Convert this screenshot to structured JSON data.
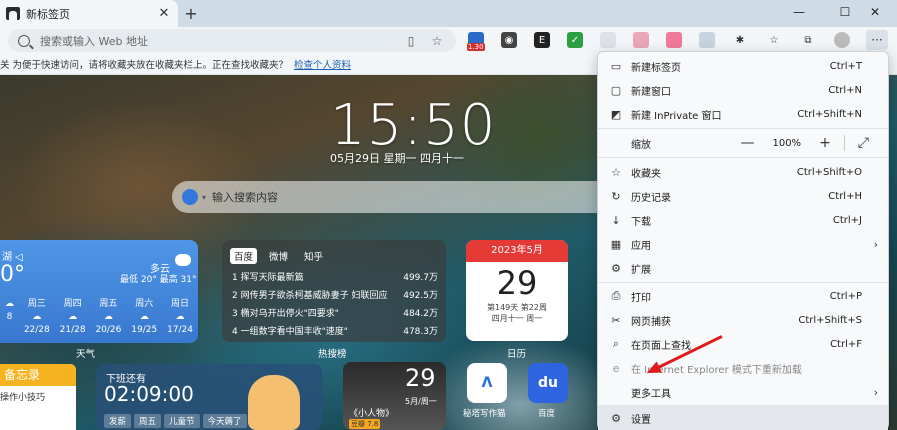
{
  "colors": {
    "accent": "#1a5fb4",
    "menu_bg": "#f7f9fb",
    "arrow": "#e11b1b",
    "weather_bg": "#4f96e6",
    "calendar_head": "#e53935"
  },
  "browser": {
    "tab_title": "新标签页",
    "tab_close": "✕",
    "new_tab": "+",
    "minimize": "—",
    "maximize": "☐",
    "close": "✕",
    "address_placeholder": "搜索或输入 Web 地址",
    "ext_badge": "1.30",
    "more": "···"
  },
  "favorites_bar": {
    "text": "关   为便于快速访问，请将收藏夹放在收藏夹栏上。正在查找收藏夹？",
    "link": "检查个人资料"
  },
  "ntp": {
    "time": "15:50",
    "date": "05月29日  星期一  四月十一",
    "search_placeholder": "输入搜索内容",
    "weather": {
      "location": "湖 ◁",
      "temp": "0°",
      "condition": "多云",
      "range": "最低 20°  最高 31°",
      "days": [
        {
          "name": "",
          "temp": "8"
        },
        {
          "name": "周三",
          "temp": "22/28"
        },
        {
          "name": "周四",
          "temp": "21/28"
        },
        {
          "name": "周五",
          "temp": "20/26"
        },
        {
          "name": "周六",
          "temp": "19/25"
        },
        {
          "name": "周日",
          "temp": "17/24"
        }
      ],
      "label": "天气"
    },
    "hot": {
      "tabs": [
        "百度",
        "微博",
        "知乎"
      ],
      "rows": [
        {
          "title": "1  挥写天际最新篇",
          "value": "499.7万"
        },
        {
          "title": "2  网传男子欲杀柯基威胁妻子 妇联回应",
          "value": "492.5万"
        },
        {
          "title": "3  椭对乌开出停火\"四要求\"",
          "value": "484.2万"
        },
        {
          "title": "4  一组数字看中国丰收\"速度\"",
          "value": "478.3万"
        }
      ],
      "label": "热搜榜"
    },
    "calendar": {
      "month": "2023年5月",
      "day": "29",
      "line1": "第149天 第22周",
      "line2": "四月十一 周一",
      "label": "日历"
    },
    "memo": {
      "title": "备忘录",
      "item": "操作小技巧"
    },
    "countdown": {
      "title": "下班还有",
      "time": "02:09:00",
      "tags": [
        "发薪",
        "周五",
        "儿童节",
        "今天薅了"
      ]
    },
    "movie": {
      "day": "29",
      "date": "5月/周一",
      "name": "《小人物》",
      "score": "豆瓣 7.8"
    },
    "apps": [
      {
        "icon": "Λ",
        "label": "秘塔写作猫",
        "color": "#1e6fd9"
      },
      {
        "icon": "du",
        "label": "百度",
        "color": "#2f64e0"
      }
    ]
  },
  "menu": {
    "items": [
      {
        "icon": "▭",
        "label": "新建标签页",
        "shortcut": "Ctrl+T"
      },
      {
        "icon": "▢",
        "label": "新建窗口",
        "shortcut": "Ctrl+N"
      },
      {
        "icon": "◩",
        "label": "新建 InPrivate 窗口",
        "shortcut": "Ctrl+Shift+N"
      },
      {
        "label": "缩放",
        "zoom": "100%",
        "minus": "—",
        "plus": "+",
        "fullscreen": "⤢"
      },
      {
        "icon": "☆",
        "label": "收藏夹",
        "shortcut": "Ctrl+Shift+O"
      },
      {
        "icon": "↻",
        "label": "历史记录",
        "shortcut": "Ctrl+H"
      },
      {
        "icon": "↓",
        "label": "下载",
        "shortcut": "Ctrl+J"
      },
      {
        "icon": "▦",
        "label": "应用",
        "chevron": "›"
      },
      {
        "icon": "⚙",
        "label": "扩展"
      },
      {
        "icon": "⎙",
        "label": "打印",
        "shortcut": "Ctrl+P"
      },
      {
        "icon": "✂",
        "label": "网页捕获",
        "shortcut": "Ctrl+Shift+S"
      },
      {
        "icon": "⌕",
        "label": "在页面上查找",
        "shortcut": "Ctrl+F"
      },
      {
        "icon": "e",
        "label": "在 Internet Explorer 模式下重新加载"
      },
      {
        "label": "更多工具",
        "chevron": "›"
      },
      {
        "icon": "⚙",
        "label": "设置"
      }
    ]
  }
}
